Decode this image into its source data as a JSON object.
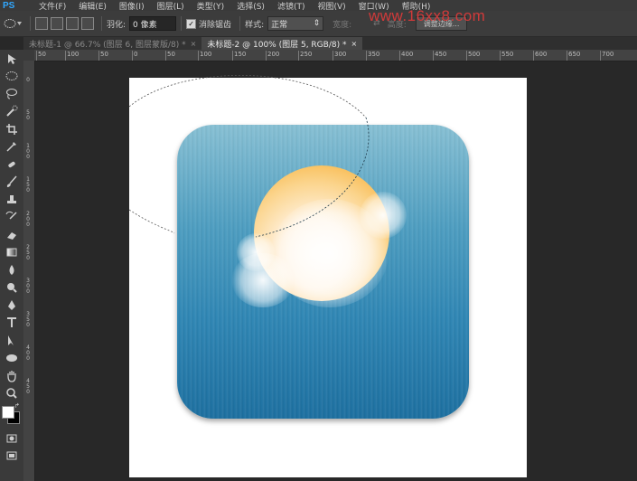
{
  "app": {
    "logo": "PS"
  },
  "menu": [
    "文件(F)",
    "编辑(E)",
    "图像(I)",
    "图层(L)",
    "类型(Y)",
    "选择(S)",
    "滤镜(T)",
    "视图(V)",
    "窗口(W)",
    "帮助(H)"
  ],
  "options": {
    "feather_label": "羽化:",
    "feather_value": "0 像素",
    "antialias_label": "消除锯齿",
    "style_label": "样式:",
    "style_value": "正常",
    "width_label": "宽度:",
    "height_label": "高度:",
    "refine_label": "调整边缘..."
  },
  "watermark": "www.16xx8.com",
  "tabs": [
    {
      "label": "未标题-1 @ 66.7% (图层 6, 图层蒙版/8) *",
      "close": "×"
    },
    {
      "label": "未标题-2 @ 100% (图层 5, RGB/8) *",
      "close": "×"
    }
  ],
  "ruler": {
    "top_labels": [
      "50",
      "100",
      "50",
      "0",
      "50",
      "100",
      "150",
      "200",
      "250",
      "300",
      "350",
      "400",
      "450",
      "500",
      "550",
      "600",
      "650",
      "700"
    ],
    "left_labels": [
      "0",
      "5 0",
      "1 0 0",
      "1 5 0",
      "2 0 0",
      "2 5 0",
      "3 0 0",
      "3 5 0",
      "4 0 0",
      "4 5 0"
    ]
  },
  "tools": [
    "move-icon",
    "ellipse-marquee-icon",
    "lasso-icon",
    "quick-select-icon",
    "crop-icon",
    "eyedropper-icon",
    "healing-icon",
    "brush-icon",
    "stamp-icon",
    "history-brush-icon",
    "eraser-icon",
    "gradient-icon",
    "blur-icon",
    "dodge-icon",
    "pen-icon",
    "type-icon",
    "path-select-icon",
    "shape-icon",
    "hand-icon",
    "zoom-icon"
  ],
  "colors": {
    "foreground": "#ffffff",
    "background": "#000000",
    "watermark": "#e23a3a"
  }
}
